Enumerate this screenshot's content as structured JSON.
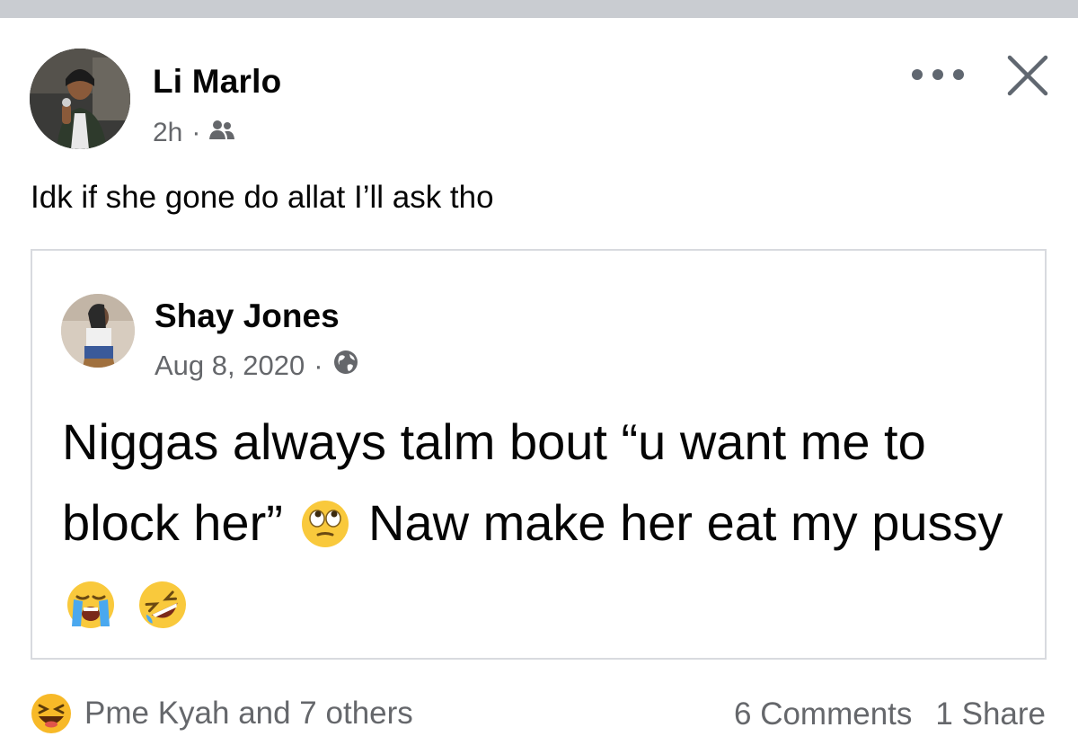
{
  "post": {
    "author": "Li Marlo",
    "time": "2h",
    "separator": "·",
    "audience_icon": "friends-icon",
    "text": "Idk if she gone do allat I’ll ask tho"
  },
  "shared_post": {
    "author": "Shay Jones",
    "date": "Aug 8, 2020",
    "separator": "·",
    "audience_icon": "globe-icon",
    "text_part1": "Niggas always talm bout “u want me to block her”",
    "text_part2": "Naw make her eat my pussy",
    "emojis": [
      "rolling-eyes-emoji",
      "loudly-crying-emoji",
      "rofl-emoji"
    ]
  },
  "footer": {
    "reaction_icon": "haha-reaction-icon",
    "reactions_text": "Pme Kyah and 7 others",
    "comments": "6 Comments",
    "shares": "1 Share"
  },
  "colors": {
    "secondary_text": "#65676b",
    "border": "#d8dadf",
    "top_strip": "#c9ccd1"
  }
}
